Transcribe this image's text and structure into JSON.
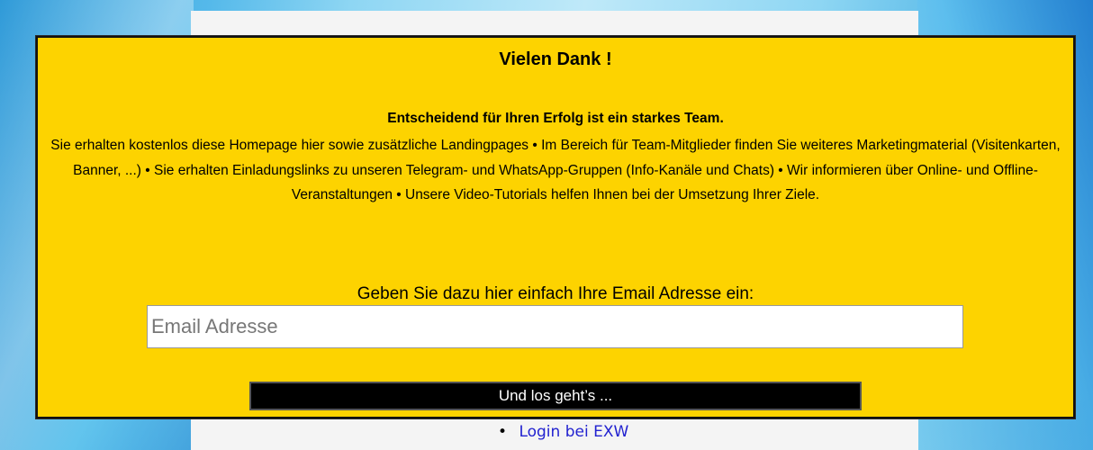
{
  "popup": {
    "title": "Vielen Dank !",
    "subtitle": "Entscheidend für Ihren Erfolg ist ein starkes Team.",
    "body": "Sie erhalten kostenlos diese Homepage hier sowie zusätzliche Landingpages • Im Bereich für Team-Mitglieder finden Sie weiteres Marketingmaterial (Visitenkarten, Banner, ...) • Sie erhalten Einladungslinks zu unseren Telegram- und WhatsApp-Gruppen (Info-Kanäle und Chats) • Wir informieren über Online- und Offline-Veranstaltungen • Unsere Video-Tutorials helfen Ihnen bei der Umsetzung Ihrer Ziele.",
    "prompt": "Geben Sie dazu hier einfach Ihre Email Adresse ein:",
    "email_placeholder": "Email Adresse",
    "submit_label": "Und los geht’s ..."
  },
  "page": {
    "nav_items": [
      {
        "label": "Login bei EXW"
      }
    ]
  },
  "colors": {
    "popup_background": "#fdd300",
    "button_background": "#000000",
    "link_color": "#2222d0"
  }
}
